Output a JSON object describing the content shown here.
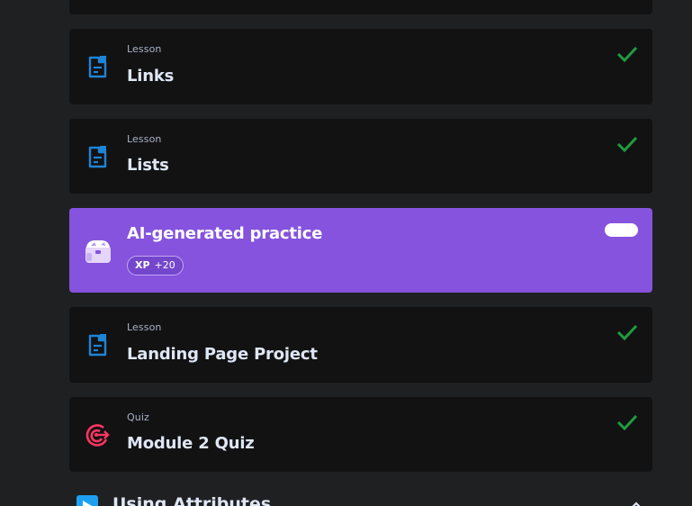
{
  "items": [
    {
      "type": "Lesson",
      "title": "Links",
      "icon": "lesson-document-icon",
      "completed": true
    },
    {
      "type": "Lesson",
      "title": "Lists",
      "icon": "lesson-document-icon",
      "completed": true
    },
    {
      "type": "",
      "title": "AI-generated practice",
      "icon": "treasure-chest-icon",
      "xp_label": "XP",
      "xp_value": "+20"
    },
    {
      "type": "Lesson",
      "title": "Landing Page Project",
      "icon": "lesson-document-icon",
      "completed": true
    },
    {
      "type": "Quiz",
      "title": "Module 2 Quiz",
      "icon": "target-icon",
      "completed": true
    }
  ],
  "next_section": {
    "title": "Using Attributes",
    "icon": "play-icon"
  },
  "colors": {
    "background": "#1f2022",
    "card": "#121213",
    "ai_card": "#8553dd",
    "check": "#1e9e3e",
    "lesson_icon": "#1e84d6",
    "quiz_icon": "#ff3562",
    "section_icon": "#1ea0f2"
  }
}
